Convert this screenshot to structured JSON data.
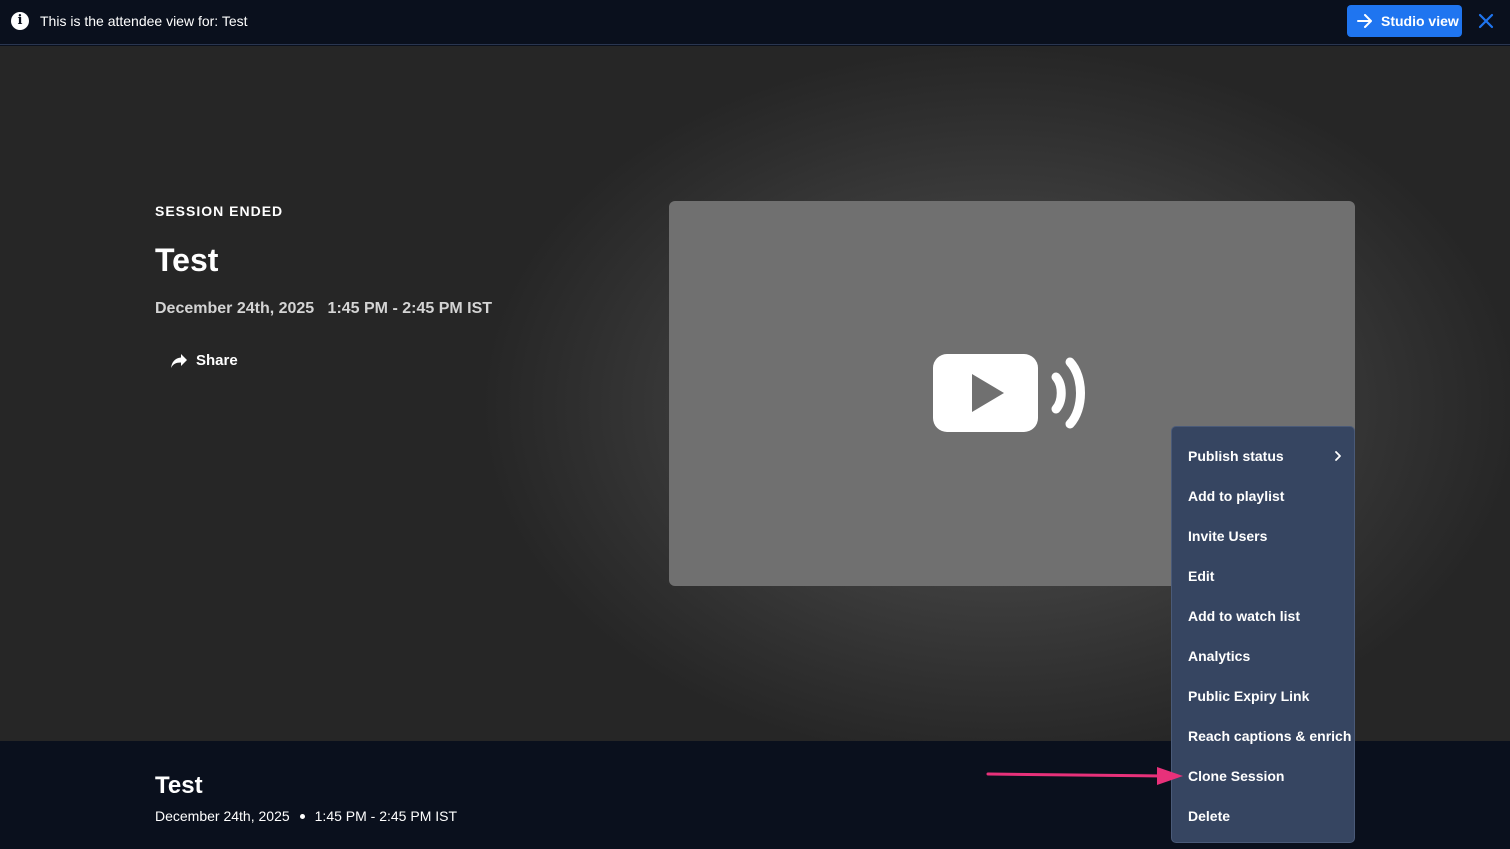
{
  "banner": {
    "text": "This is the attendee view for: Test",
    "studio_button_label": "Studio view",
    "icons": {
      "info": "info-icon",
      "arrow": "arrow-right-icon",
      "close": "close-icon"
    }
  },
  "hero": {
    "status": "SESSION ENDED",
    "title": "Test",
    "datetime": "December 24th, 2025   1:45 PM - 2:45 PM IST",
    "share_label": "Share"
  },
  "bottom": {
    "title": "Test",
    "date": "December 24th, 2025",
    "time": "1:45 PM - 2:45 PM IST"
  },
  "menu": {
    "items": [
      {
        "label": "Publish status",
        "has_submenu": true
      },
      {
        "label": "Add to playlist"
      },
      {
        "label": "Invite Users"
      },
      {
        "label": "Edit"
      },
      {
        "label": "Add to watch list"
      },
      {
        "label": "Analytics"
      },
      {
        "label": "Public Expiry Link"
      },
      {
        "label": "Reach captions & enrich"
      },
      {
        "label": "Clone Session"
      },
      {
        "label": "Delete"
      }
    ]
  },
  "colors": {
    "accent": "#1f75f0",
    "banner_bg": "#0a101d",
    "menu_bg": "#364561",
    "annotation": "#e8317a"
  }
}
